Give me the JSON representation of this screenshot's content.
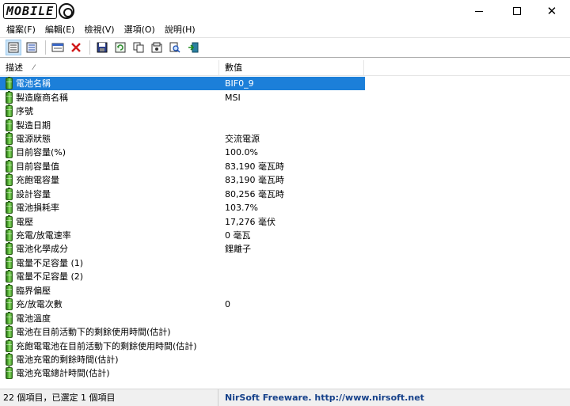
{
  "window": {
    "logo_text": "MOBILE",
    "minimize_symbol": "—",
    "maximize_symbol": "☐",
    "close_symbol": "✕"
  },
  "menu": [
    "檔案(F)",
    "編輯(E)",
    "檢視(V)",
    "選項(O)",
    "說明(H)"
  ],
  "toolbar": {
    "icons": [
      "details-view-icon",
      "list-view-icon",
      "properties-icon",
      "delete-icon",
      "save-icon",
      "refresh-icon",
      "copy-icon",
      "html-report-icon",
      "find-icon",
      "exit-icon"
    ]
  },
  "colors": {
    "selection": "#1c7fd9",
    "battery_green": "#5fbe3b",
    "delete_red": "#d11a1a",
    "link_blue": "#16418a"
  },
  "columns": {
    "description": "描述",
    "value": "數值"
  },
  "rows": [
    {
      "desc": "電池名稱",
      "value": "BIF0_9",
      "selected": true
    },
    {
      "desc": "製造廠商名稱",
      "value": "MSI"
    },
    {
      "desc": "序號",
      "value": ""
    },
    {
      "desc": "製造日期",
      "value": ""
    },
    {
      "desc": "電源狀態",
      "value": "交流電源"
    },
    {
      "desc": "目前容量(%)",
      "value": "100.0%"
    },
    {
      "desc": "目前容量值",
      "value": "83,190 毫瓦時"
    },
    {
      "desc": "充飽電容量",
      "value": "83,190 毫瓦時"
    },
    {
      "desc": "設計容量",
      "value": "80,256 毫瓦時"
    },
    {
      "desc": "電池損耗率",
      "value": "103.7%"
    },
    {
      "desc": "電壓",
      "value": "17,276 毫伏"
    },
    {
      "desc": "充電/放電速率",
      "value": "0 毫瓦"
    },
    {
      "desc": "電池化學成分",
      "value": "鋰離子"
    },
    {
      "desc": "電量不足容量 (1)",
      "value": ""
    },
    {
      "desc": "電量不足容量 (2)",
      "value": ""
    },
    {
      "desc": "臨界偏壓",
      "value": ""
    },
    {
      "desc": "充/放電次數",
      "value": "0"
    },
    {
      "desc": "電池溫度",
      "value": ""
    },
    {
      "desc": "電池在目前活動下的剩餘使用時間(估計)",
      "value": ""
    },
    {
      "desc": "充飽電電池在目前活動下的剩餘使用時間(估計)",
      "value": ""
    },
    {
      "desc": "電池充電的剩餘時間(估計)",
      "value": ""
    },
    {
      "desc": "電池充電總計時間(估計)",
      "value": ""
    }
  ],
  "status": {
    "items_text": "22 個項目，已選定 1 個項目",
    "credit_text": "NirSoft Freeware.  http://www.nirsoft.net"
  }
}
